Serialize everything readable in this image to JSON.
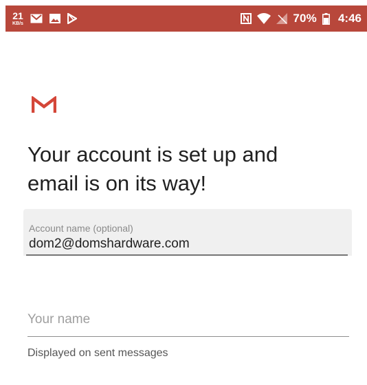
{
  "status_bar": {
    "net_speed_value": "21",
    "net_speed_unit": "KB/s",
    "battery_percent": "70%",
    "time": "4:46",
    "icons": [
      "gmail-notification-icon",
      "image-notification-icon",
      "play-store-icon",
      "nfc-icon",
      "wifi-icon",
      "no-signal-icon",
      "battery-icon"
    ]
  },
  "colors": {
    "status_bar": "#b8473b",
    "gmail_red": "#d44638",
    "text_primary": "#212121"
  },
  "setup": {
    "headline_line1": "Your account is set up and",
    "headline_line2": "email is on its way!"
  },
  "account_name_field": {
    "label": "Account name (optional)",
    "value": "dom2@domshardware.com"
  },
  "your_name_field": {
    "placeholder": "Your name",
    "value": "",
    "helper": "Displayed on sent messages"
  }
}
